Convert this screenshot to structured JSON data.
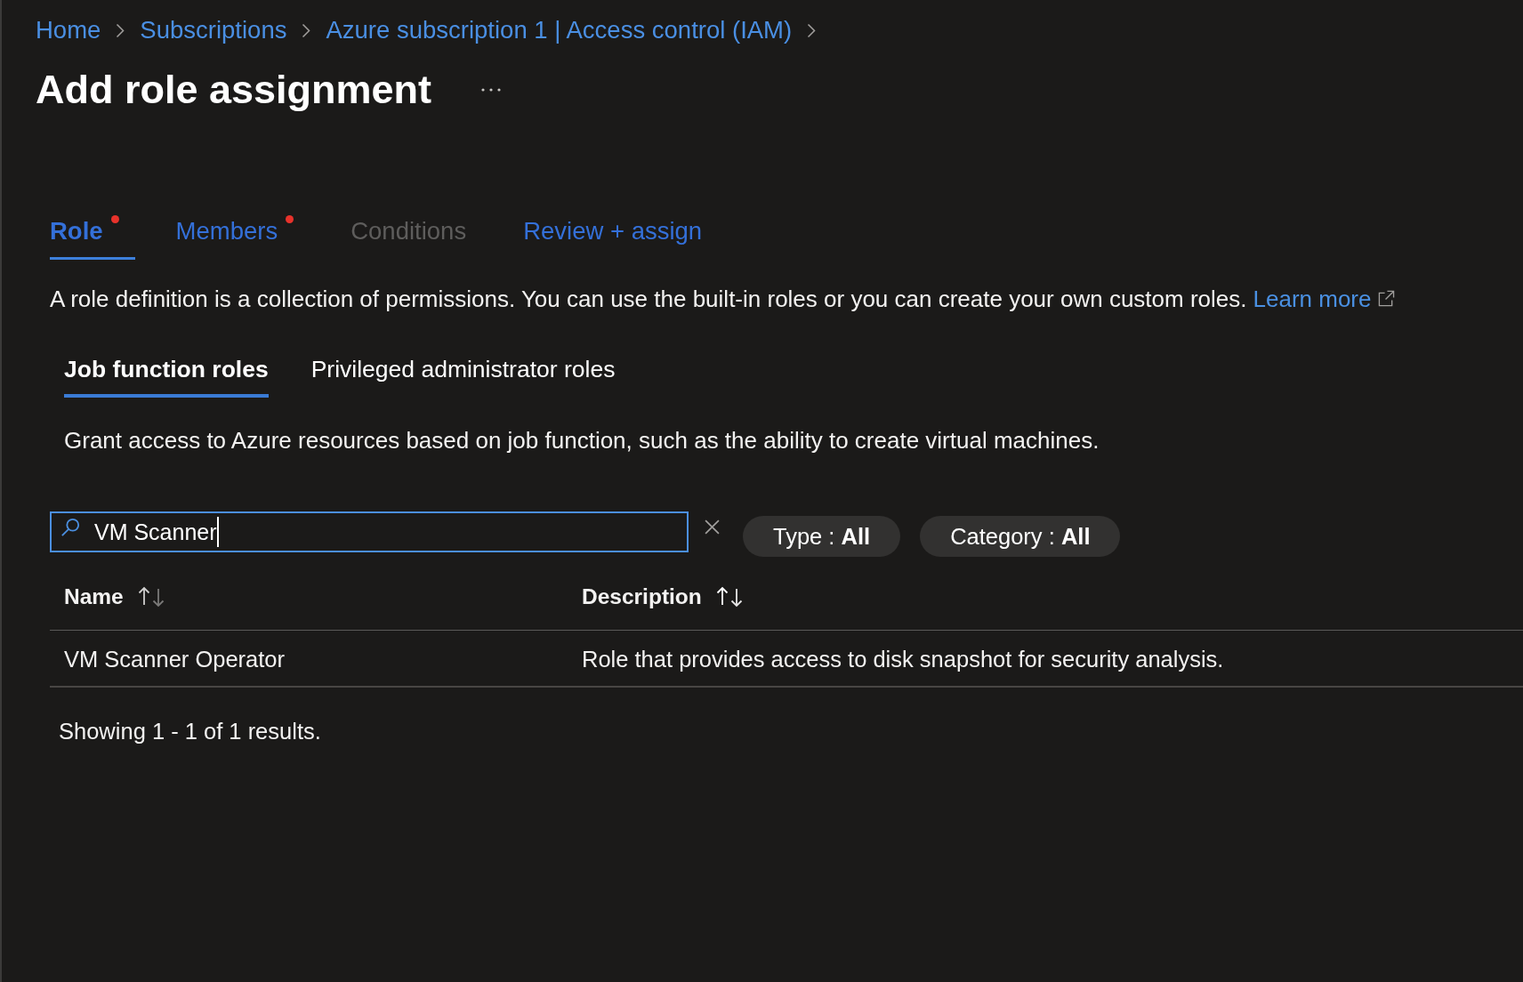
{
  "breadcrumb": [
    {
      "label": "Home"
    },
    {
      "label": "Subscriptions"
    },
    {
      "label": "Azure subscription 1 | Access control (IAM)"
    }
  ],
  "page": {
    "title": "Add role assignment"
  },
  "tabs": [
    {
      "label": "Role",
      "selected": true,
      "disabled": false,
      "incomplete": true
    },
    {
      "label": "Members",
      "selected": false,
      "disabled": false,
      "incomplete": true
    },
    {
      "label": "Conditions",
      "selected": false,
      "disabled": true,
      "incomplete": false
    },
    {
      "label": "Review + assign",
      "selected": false,
      "disabled": false,
      "incomplete": false
    }
  ],
  "intro": {
    "text": "A role definition is a collection of permissions. You can use the built-in roles or you can create your own custom roles.",
    "link": "Learn more"
  },
  "role_tabs": [
    {
      "label": "Job function roles",
      "selected": true
    },
    {
      "label": "Privileged administrator roles",
      "selected": false
    }
  ],
  "role_tab_description": "Grant access to Azure resources based on job function, such as the ability to create virtual machines.",
  "search": {
    "value": "VM Scanner",
    "focused": true
  },
  "filters": [
    {
      "label": "Type : **All**"
    },
    {
      "label": "Category : **All**"
    }
  ],
  "table": {
    "columns": [
      {
        "label": "Name",
        "hovered": false
      },
      {
        "label": "Description",
        "hovered": true
      }
    ],
    "rows": [
      {
        "cells": [
          "VM Scanner Operator",
          "Role that provides access to disk snapshot for security analysis."
        ]
      }
    ]
  },
  "results_summary": "Showing 1 - 1 of 1 results."
}
